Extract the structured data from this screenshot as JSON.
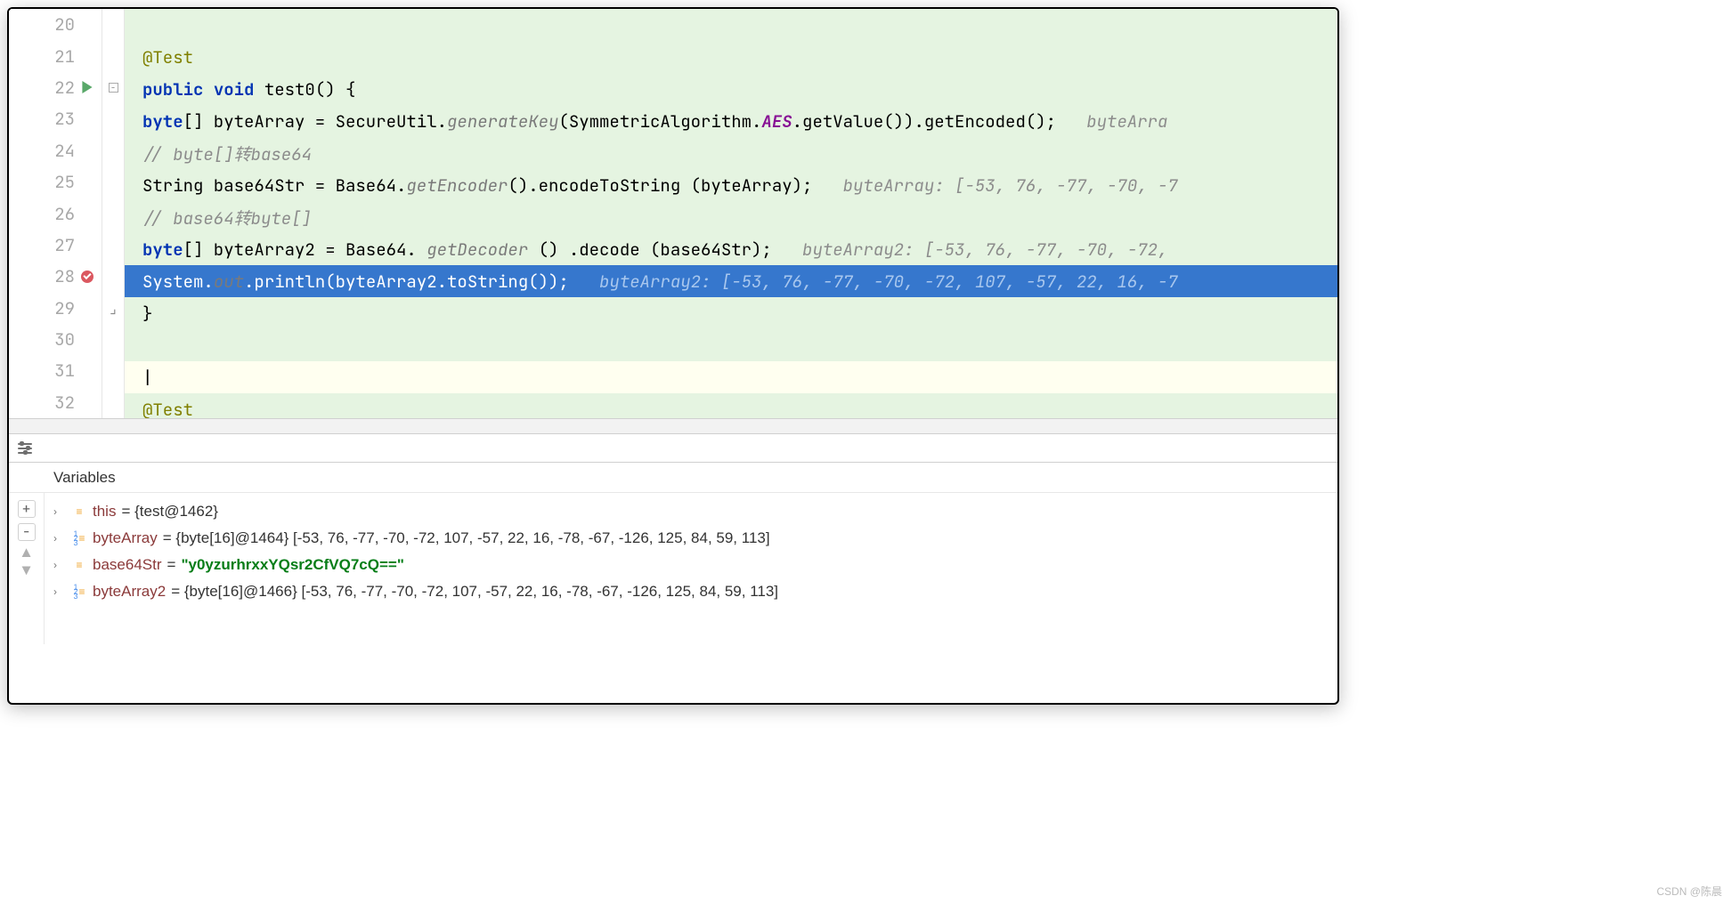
{
  "editor": {
    "lines": [
      {
        "num": "20",
        "run": false,
        "bp": false,
        "fold": "",
        "type": "green",
        "html": ""
      },
      {
        "num": "21",
        "run": false,
        "bp": false,
        "fold": "",
        "type": "green",
        "indent": 2,
        "tokens": [
          {
            "t": "@Test",
            "c": "an"
          }
        ]
      },
      {
        "num": "22",
        "run": true,
        "bp": false,
        "fold": "minus",
        "type": "green",
        "indent": 2,
        "tokens": [
          {
            "t": "public ",
            "c": "kw"
          },
          {
            "t": "void ",
            "c": "kw"
          },
          {
            "t": "test0() {"
          }
        ]
      },
      {
        "num": "23",
        "run": false,
        "bp": false,
        "fold": "",
        "type": "green",
        "indent": 3,
        "tokens": [
          {
            "t": "byte",
            "c": "kw"
          },
          {
            "t": "[] byteArray = SecureUtil."
          },
          {
            "t": "generateKey",
            "c": "st-it"
          },
          {
            "t": "(SymmetricAlgorithm."
          },
          {
            "t": "AES",
            "c": "st-it-pink"
          },
          {
            "t": ".getValue()).getEncoded();   "
          },
          {
            "t": "byteArra",
            "c": "inlay"
          }
        ]
      },
      {
        "num": "24",
        "run": false,
        "bp": false,
        "fold": "",
        "type": "green",
        "indent": 3,
        "tokens": [
          {
            "t": "// byte[]转base64",
            "c": "cmt"
          }
        ]
      },
      {
        "num": "25",
        "run": false,
        "bp": false,
        "fold": "",
        "type": "green",
        "indent": 3,
        "tokens": [
          {
            "t": "String base64Str = Base64."
          },
          {
            "t": "getEncoder",
            "c": "st-it"
          },
          {
            "t": "().encodeToString (byteArray);   "
          },
          {
            "t": "byteArray: [-53, 76, -77, -70, -7",
            "c": "inlay"
          }
        ]
      },
      {
        "num": "26",
        "run": false,
        "bp": false,
        "fold": "",
        "type": "green",
        "indent": 3,
        "tokens": [
          {
            "t": "// base64转byte[]",
            "c": "cmt"
          }
        ]
      },
      {
        "num": "27",
        "run": false,
        "bp": false,
        "fold": "",
        "type": "green",
        "indent": 3,
        "tokens": [
          {
            "t": "byte",
            "c": "kw"
          },
          {
            "t": "[] byteArray2 = Base64. "
          },
          {
            "t": "getDecoder",
            "c": "st-it"
          },
          {
            "t": " () .decode (base64Str);   "
          },
          {
            "t": "byteArray2: [-53, 76, -77, -70, -72,",
            "c": "inlay"
          }
        ]
      },
      {
        "num": "28",
        "run": false,
        "bp": true,
        "fold": "",
        "type": "hl",
        "indent": 3,
        "tokens": [
          {
            "t": "System."
          },
          {
            "t": "out",
            "c": "st-it"
          },
          {
            "t": ".println(byteArray2.toString());   "
          },
          {
            "t": "byteArray2: [-53, 76, -77, -70, -72, 107, -57, 22, 16, -7",
            "c": "inlay"
          }
        ]
      },
      {
        "num": "29",
        "run": false,
        "bp": false,
        "fold": "end",
        "type": "green",
        "indent": 2,
        "tokens": [
          {
            "t": "}"
          }
        ]
      },
      {
        "num": "30",
        "run": false,
        "bp": false,
        "fold": "",
        "type": "green",
        "html": ""
      },
      {
        "num": "31",
        "run": false,
        "bp": false,
        "fold": "",
        "type": "plain",
        "indent": 2,
        "tokens": [
          {
            "t": "|"
          }
        ]
      },
      {
        "num": "32",
        "run": false,
        "bp": false,
        "fold": "",
        "type": "green",
        "indent": 2,
        "tokens": [
          {
            "t": "@Test",
            "c": "an"
          }
        ]
      }
    ]
  },
  "debugger": {
    "tab_label": "Variables",
    "vars": [
      {
        "icon": "obj",
        "name": "this",
        "val": " = {test@1462}",
        "str": false
      },
      {
        "icon": "arr",
        "name": "byteArray",
        "val": " = {byte[16]@1464} [-53, 76, -77, -70, -72, 107, -57, 22, 16, -78, -67, -126, 125, 84, 59, 113]",
        "str": false
      },
      {
        "icon": "obj",
        "name": "base64Str",
        "val": " = ",
        "str": true,
        "strval": "\"y0yzurhrxxYQsr2CfVQ7cQ==\""
      },
      {
        "icon": "arr",
        "name": "byteArray2",
        "val": " = {byte[16]@1466} [-53, 76, -77, -70, -72, 107, -57, 22, 16, -78, -67, -126, 125, 84, 59, 113]",
        "str": false
      }
    ]
  },
  "watermark": "CSDN @陈晨"
}
